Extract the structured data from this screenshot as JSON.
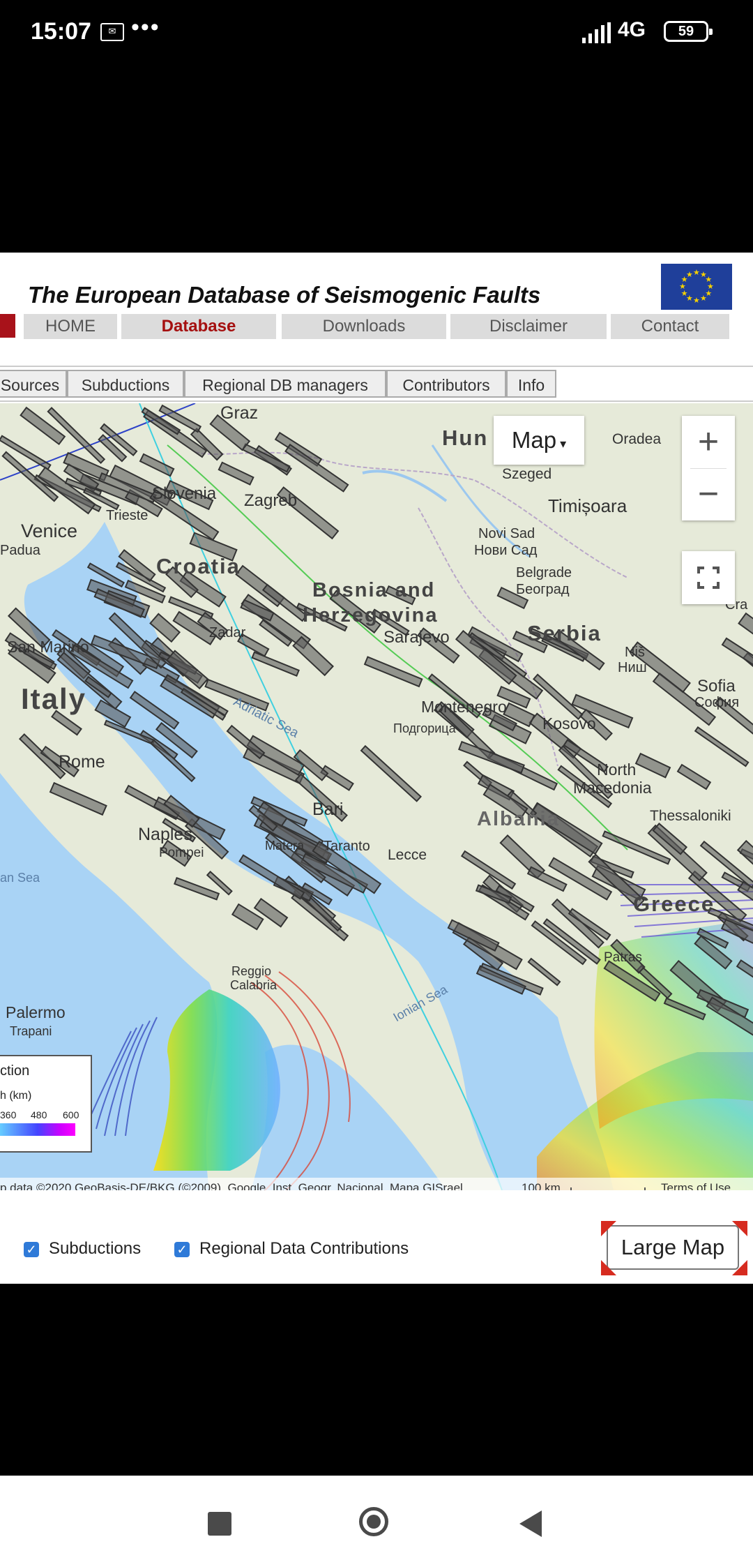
{
  "status_bar": {
    "time": "15:07",
    "network": "4G",
    "battery": "59"
  },
  "site": {
    "title": "The European Database of Seismogenic Faults"
  },
  "nav": [
    {
      "label": "HOME"
    },
    {
      "label": "Database"
    },
    {
      "label": "Downloads"
    },
    {
      "label": "Disclaimer"
    },
    {
      "label": "Contact"
    }
  ],
  "tabs": [
    {
      "label": "Sources"
    },
    {
      "label": "Subductions"
    },
    {
      "label": "Regional DB managers"
    },
    {
      "label": "Contributors"
    },
    {
      "label": "Info"
    }
  ],
  "map": {
    "type_button": "Map",
    "zoom_in": "+",
    "zoom_out": "−",
    "labels": {
      "graz": "Graz",
      "hungary": "Hun",
      "oradea": "Oradea",
      "szeged": "Szeged",
      "timisoara": "Timișoara",
      "slovenia": "Slovenia",
      "zagreb": "Zagreb",
      "trieste": "Trieste",
      "venice": "Venice",
      "padua": "Padua",
      "croatia": "Croatia",
      "novi_sad": "Novi Sad",
      "novi_sad_cyr": "Нови Сад",
      "belgrade": "Belgrade",
      "belgrade_cyr": "Београд",
      "bosnia": "Bosnia and",
      "herzegovina": "Herzegovina",
      "zadar": "Zadar",
      "serbia": "Serbia",
      "sarajevo": "Sarajevo",
      "san_marino": "San Marino",
      "italy": "Italy",
      "adriatic": "Adriatic Sea",
      "montenegro": "Montenegro",
      "podgorica_cyr": "Подгорица",
      "kosovo": "Kosovo",
      "nis": "Niš",
      "nis_cyr": "Ниш",
      "sofia": "Sofia",
      "sofia_cyr": "София",
      "rome": "Rome",
      "north": "North",
      "macedonia": "Macedonia",
      "bari": "Bari",
      "naples": "Naples",
      "pompei": "Pompei",
      "matera": "Matera",
      "taranto": "Taranto",
      "lecce": "Lecce",
      "albania": "Albania",
      "thessaloniki": "Thessaloniki",
      "greece": "Greece",
      "patras": "Patras",
      "reggio": "Reggio",
      "calabria": "Calabria",
      "palermo": "Palermo",
      "trapani": "Trapani",
      "tyrrhenian": "an Sea",
      "ionian": "Ionian Sea",
      "craiova": "Cra"
    },
    "legend": {
      "title": "ction",
      "subtitle": "h (km)",
      "ticks": [
        "360",
        "480",
        "600"
      ]
    },
    "attribution": "p data ©2020 GeoBasis-DE/BKG (©2009), Google, Inst. Geogr. Nacional, Mapa GISrael",
    "scale": "100 km",
    "terms": "Terms of Use"
  },
  "checkboxes": [
    {
      "label": "Subductions"
    },
    {
      "label": "Regional Data Contributions"
    }
  ],
  "large_map_button": "Large Map",
  "colors": {
    "nav_active": "#a51010",
    "checkbox": "#2f7ad8",
    "sea": "#a9d3f5",
    "land": "#e8ecdc"
  }
}
